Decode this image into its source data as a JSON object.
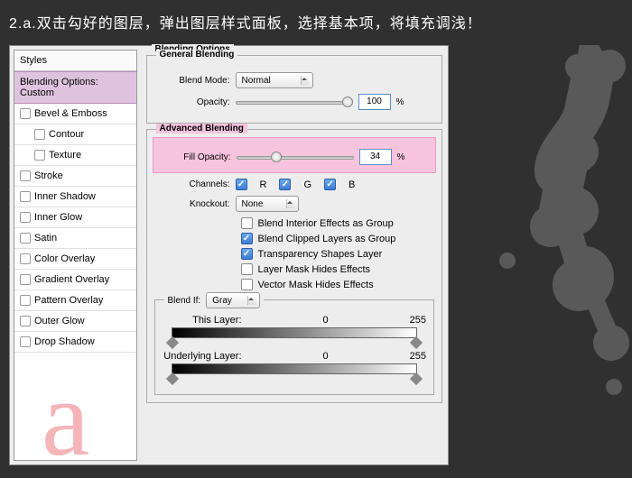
{
  "instruction": "2.a.双击勾好的图层，弹出图层样式面板，选择基本项，将填充调浅！",
  "sidebar": {
    "header": "Styles",
    "items": [
      {
        "label": "Blending Options: Custom",
        "selected": true,
        "checkbox": false
      },
      {
        "label": "Bevel & Emboss",
        "checkbox": true
      },
      {
        "label": "Contour",
        "checkbox": true,
        "sub": true
      },
      {
        "label": "Texture",
        "checkbox": true,
        "sub": true
      },
      {
        "label": "Stroke",
        "checkbox": true
      },
      {
        "label": "Inner Shadow",
        "checkbox": true
      },
      {
        "label": "Inner Glow",
        "checkbox": true
      },
      {
        "label": "Satin",
        "checkbox": true
      },
      {
        "label": "Color Overlay",
        "checkbox": true
      },
      {
        "label": "Gradient Overlay",
        "checkbox": true
      },
      {
        "label": "Pattern Overlay",
        "checkbox": true
      },
      {
        "label": "Outer Glow",
        "checkbox": true
      },
      {
        "label": "Drop Shadow",
        "checkbox": true
      }
    ]
  },
  "main": {
    "title": "Blending Options",
    "general": {
      "label": "General Blending",
      "blend_mode_label": "Blend Mode:",
      "blend_mode_value": "Normal",
      "opacity_label": "Opacity:",
      "opacity_value": "100",
      "pct": "%"
    },
    "advanced": {
      "label": "Advanced Blending",
      "fill_opacity_label": "Fill Opacity:",
      "fill_opacity_value": "34",
      "pct": "%",
      "channels_label": "Channels:",
      "ch_r": "R",
      "ch_g": "G",
      "ch_b": "B",
      "knockout_label": "Knockout:",
      "knockout_value": "None",
      "opts": [
        {
          "label": "Blend Interior Effects as Group",
          "on": false
        },
        {
          "label": "Blend Clipped Layers as Group",
          "on": true
        },
        {
          "label": "Transparency Shapes Layer",
          "on": true
        },
        {
          "label": "Layer Mask Hides Effects",
          "on": false
        },
        {
          "label": "Vector Mask Hides Effects",
          "on": false
        }
      ]
    },
    "blendif": {
      "label": "Blend If:",
      "value": "Gray",
      "this_label": "This Layer:",
      "this_lo": "0",
      "this_hi": "255",
      "under_label": "Underlying Layer:",
      "under_lo": "0",
      "under_hi": "255"
    }
  },
  "watermark": "a"
}
